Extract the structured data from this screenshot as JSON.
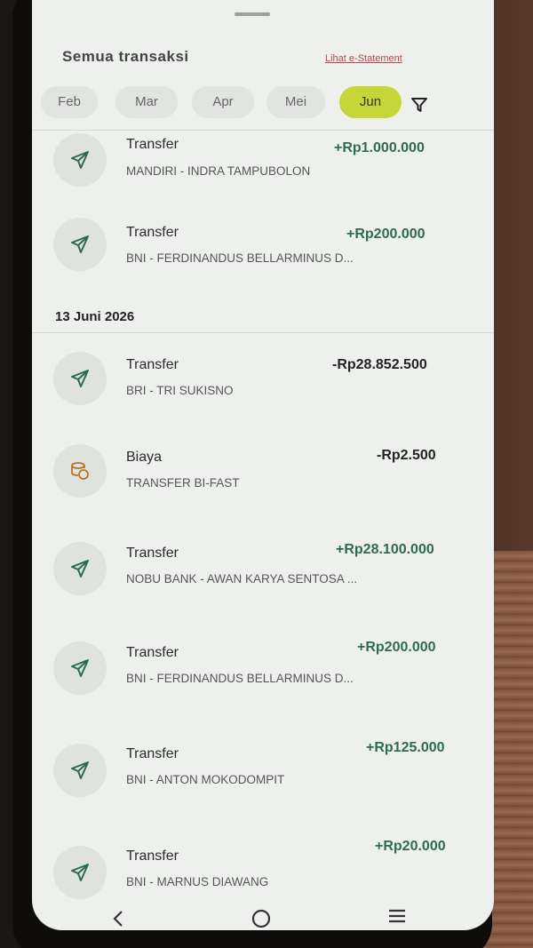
{
  "header": {
    "title": "Semua transaksi",
    "link": "Lihat e-Statement"
  },
  "months": {
    "items": [
      "Feb",
      "Mar",
      "Apr",
      "Mei",
      "Jun"
    ],
    "selected": "Jun"
  },
  "date_group": "13 Juni 2026",
  "transactions_top": [
    {
      "type": "Transfer",
      "desc": "MANDIRI - INDRA TAMPUBOLON",
      "amount": "+Rp1.000.000",
      "icon": "send-icon"
    },
    {
      "type": "Transfer",
      "desc": "BNI - FERDINANDUS BELLARMINUS D...",
      "amount": "+Rp200.000",
      "icon": "send-icon"
    }
  ],
  "transactions": [
    {
      "type": "Transfer",
      "desc": "BRI - TRI SUKISNO",
      "amount": "-Rp28.852.500",
      "icon": "send-icon"
    },
    {
      "type": "Biaya",
      "desc": "TRANSFER BI-FAST",
      "amount": "-Rp2.500",
      "icon": "fee-coins-icon"
    },
    {
      "type": "Transfer",
      "desc": "NOBU BANK - AWAN KARYA SENTOSA ...",
      "amount": "+Rp28.100.000",
      "icon": "send-icon"
    },
    {
      "type": "Transfer",
      "desc": "BNI - FERDINANDUS BELLARMINUS D...",
      "amount": "+Rp200.000",
      "icon": "send-icon"
    },
    {
      "type": "Transfer",
      "desc": "BNI - ANTON MOKODOMPIT",
      "amount": "+Rp125.000",
      "icon": "send-icon"
    },
    {
      "type": "Transfer",
      "desc": "BNI - MARNUS DIAWANG",
      "amount": "+Rp20.000",
      "icon": "send-icon"
    }
  ],
  "colors": {
    "accent": "#c8d538",
    "positive": "#2f6b4e",
    "link": "#b64848"
  }
}
